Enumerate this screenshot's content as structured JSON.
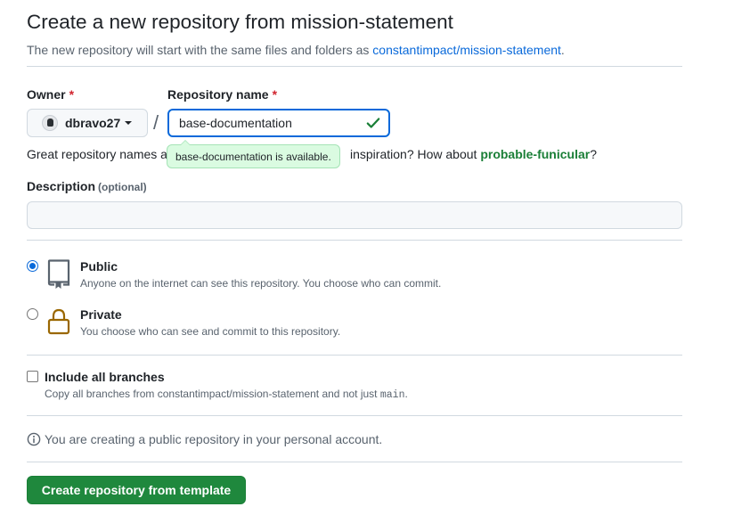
{
  "header": {
    "title": "Create a new repository from mission-statement",
    "subtitle_prefix": "The new repository will start with the same files and folders as",
    "template_link": "constantimpact/mission-statement",
    "subtitle_suffix": "."
  },
  "form": {
    "owner": {
      "label": "Owner",
      "required_mark": "*",
      "value": "dbravo27"
    },
    "separator": "/",
    "repo_name": {
      "label": "Repository name",
      "required_mark": "*",
      "value": "base-documentation",
      "availability_tooltip": "base-documentation is available."
    },
    "hint": {
      "prefix": "Great repository names a",
      "middle": "inspiration? How about",
      "suggestion": "probable-funicular",
      "suffix": "?"
    },
    "description": {
      "label": "Description",
      "optional": "(optional)",
      "value": ""
    },
    "visibility": {
      "selected": "public",
      "options": [
        {
          "id": "public",
          "title": "Public",
          "description": "Anyone on the internet can see this repository. You choose who can commit."
        },
        {
          "id": "private",
          "title": "Private",
          "description": "You choose who can see and commit to this repository."
        }
      ]
    },
    "include_branches": {
      "checked": false,
      "title": "Include all branches",
      "description_prefix": "Copy all branches from constantimpact/mission-statement and not just",
      "branch": "main",
      "description_suffix": "."
    },
    "info": "You are creating a public repository in your personal account.",
    "submit_label": "Create repository from template"
  },
  "colors": {
    "primary_button": "#1f883d",
    "link": "#0969da",
    "success": "#1a7f37",
    "required": "#d1242f",
    "lock_icon": "#9a6700"
  }
}
